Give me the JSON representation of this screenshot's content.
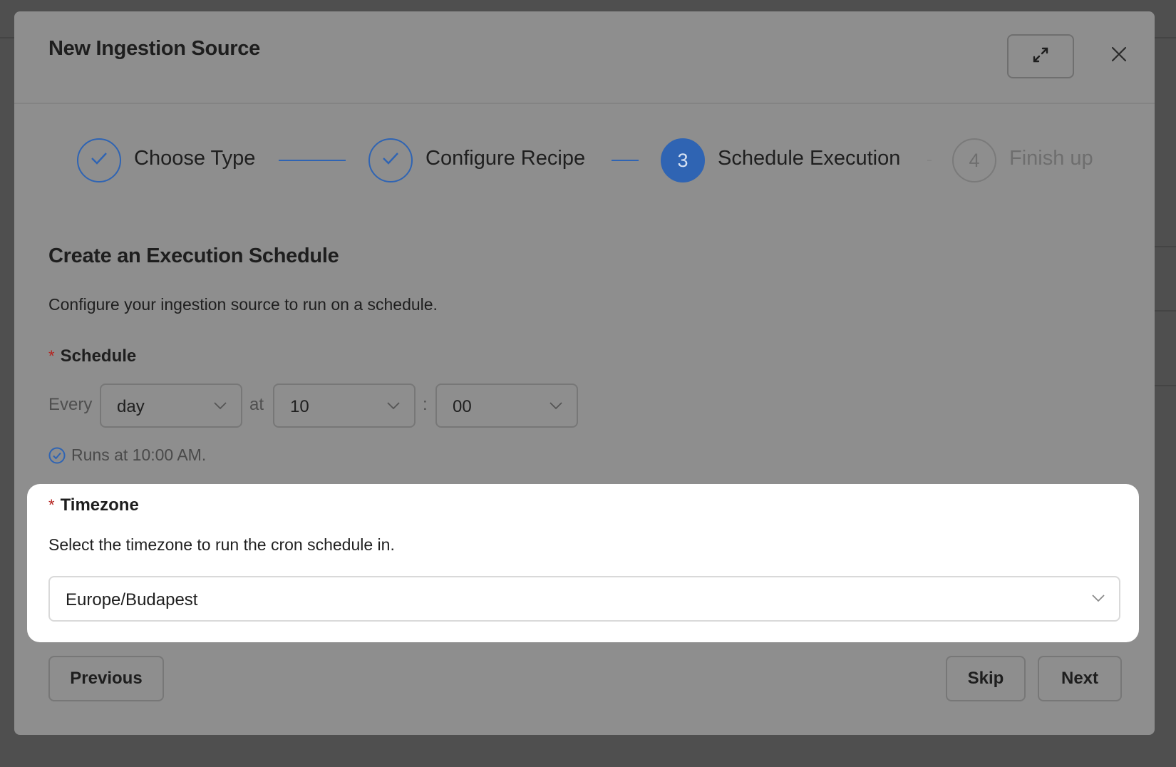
{
  "modal": {
    "title": "New Ingestion Source"
  },
  "steps": [
    {
      "label": "Choose Type",
      "status": "done"
    },
    {
      "label": "Configure Recipe",
      "status": "done"
    },
    {
      "label": "Schedule Execution",
      "status": "active",
      "number": "3"
    },
    {
      "label": "Finish up",
      "status": "wait",
      "number": "4"
    }
  ],
  "section": {
    "title": "Create an Execution Schedule",
    "description": "Configure your ingestion source to run on a schedule."
  },
  "schedule": {
    "label": "Schedule",
    "required_mark": "*",
    "every_text": "Every",
    "interval": "day",
    "at_text": "at",
    "hour": "10",
    "separator": ":",
    "minute": "00",
    "hint": "Runs at 10:00 AM."
  },
  "timezone": {
    "label": "Timezone",
    "required_mark": "*",
    "description": "Select the timezone to run the cron schedule in.",
    "value": "Europe/Budapest"
  },
  "footer": {
    "previous_label": "Previous",
    "skip_label": "Skip",
    "next_label": "Next"
  },
  "colors": {
    "primary": "#2f64b3",
    "required": "#b5231f",
    "overlay_modal": "#8e8e8e"
  },
  "icons": {
    "expand": "expand-arrows-icon",
    "close": "close-icon",
    "step_done": "check-icon",
    "select_arrow": "chevron-down-icon",
    "hint": "check-circle-icon"
  }
}
